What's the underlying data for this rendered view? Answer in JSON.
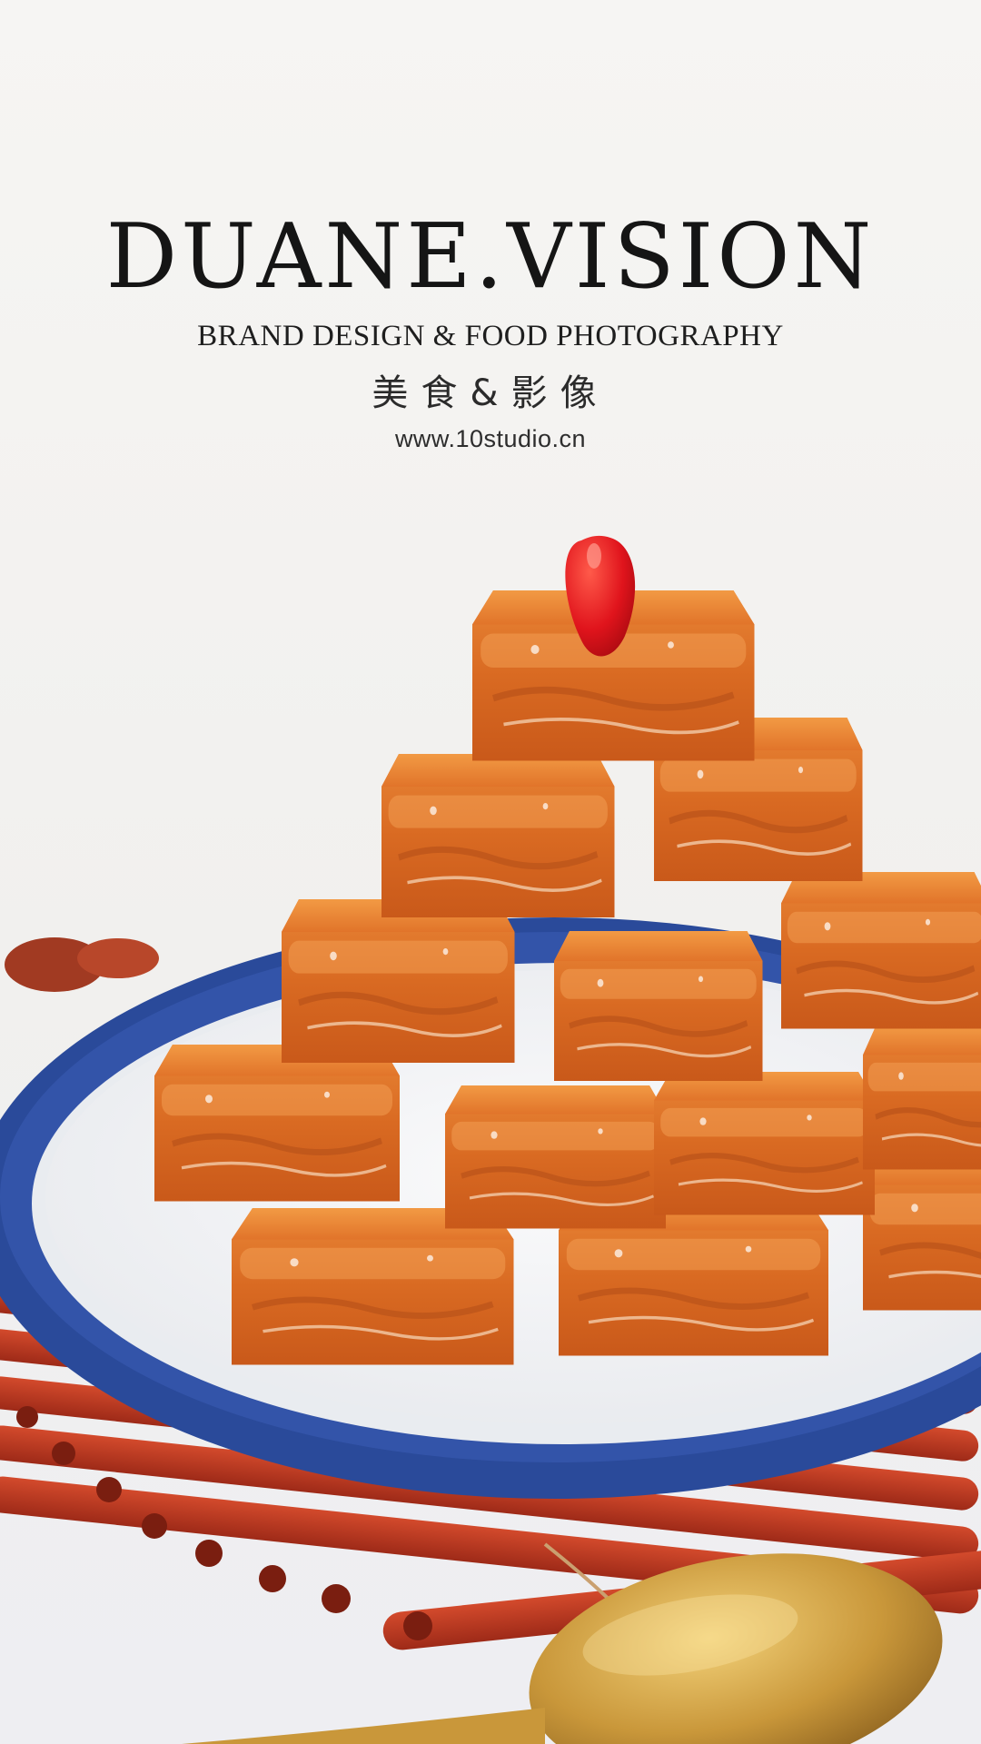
{
  "brand": {
    "title": "DUANE.VISION",
    "subtitle": "BRAND DESIGN & FOOD PHOTOGRAPHY",
    "chinese": "美食&影像",
    "website": "www.10studio.cn"
  },
  "colors": {
    "background": "#f3f2f0",
    "plate_rim": "#2f4f9e",
    "plate_center": "#f6f7f9",
    "tofu_glaze": "#e0782a",
    "chili": "#d8141a",
    "chopsticks": "#b8321f",
    "spoon": "#c99a3a"
  }
}
